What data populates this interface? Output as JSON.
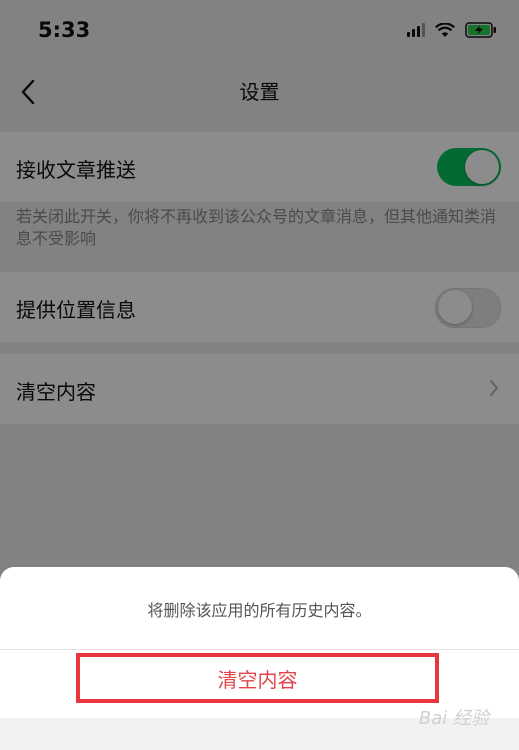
{
  "status_bar": {
    "time": "5:33"
  },
  "nav": {
    "title": "设置"
  },
  "settings": {
    "receive_articles": {
      "label": "接收文章推送",
      "enabled": true
    },
    "hint": "若关闭此开关，你将不再收到该公众号的文章消息，但其他通知类消息不受影响",
    "location": {
      "label": "提供位置信息",
      "enabled": false
    },
    "clear": {
      "label": "清空内容"
    }
  },
  "action_sheet": {
    "message": "将删除该应用的所有历史内容。",
    "confirm_label": "清空内容"
  },
  "watermark": "Bai 经验",
  "colors": {
    "toggle_on": "#07c160",
    "danger": "#e0464a",
    "highlight_box": "#e8363d"
  },
  "icons": [
    "signal-icon",
    "wifi-icon",
    "battery-charging-icon",
    "back-arrow-icon",
    "chevron-right-icon"
  ]
}
